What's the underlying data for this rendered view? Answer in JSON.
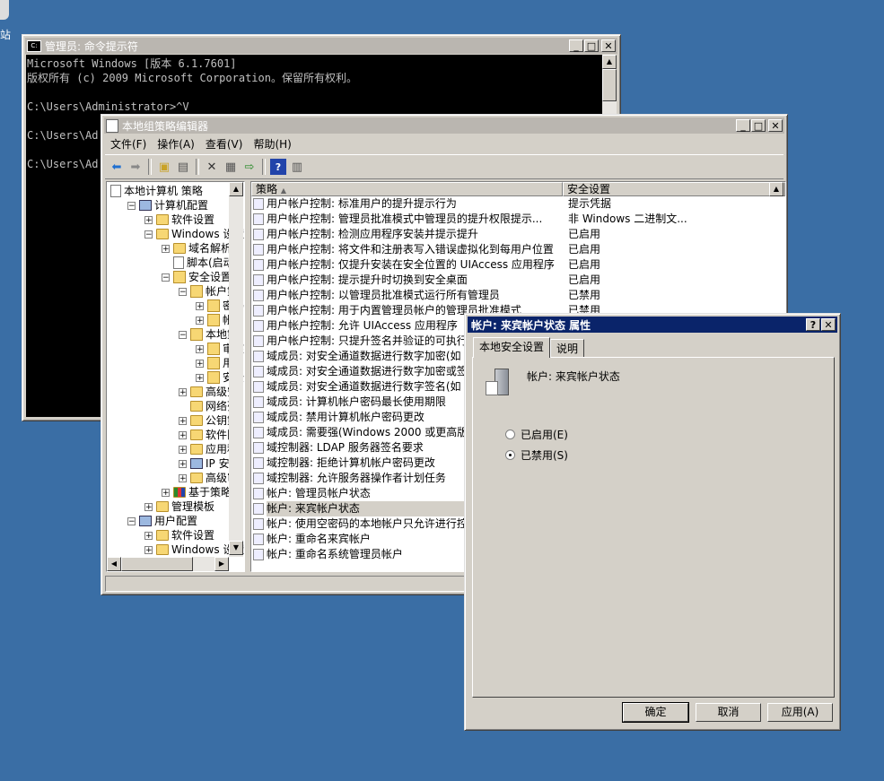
{
  "desktop": {
    "icon_label": "站"
  },
  "cmd": {
    "title": "管理员: 命令提示符",
    "lines": [
      "Microsoft Windows [版本 6.1.7601]",
      "版权所有 (c) 2009 Microsoft Corporation。保留所有权利。",
      "",
      "C:\\Users\\Administrator>^V",
      "",
      "C:\\Users\\Ad",
      "",
      "C:\\Users\\Ad"
    ]
  },
  "gpedit": {
    "title": "本地组策略编辑器",
    "menu": [
      "文件(F)",
      "操作(A)",
      "查看(V)",
      "帮助(H)"
    ],
    "tree": [
      {
        "label": "本地计算机 策略",
        "indent": 0,
        "icon": "doc-icon",
        "exp": ""
      },
      {
        "label": "计算机配置",
        "indent": 1,
        "icon": "computer-icon",
        "exp": "−"
      },
      {
        "label": "软件设置",
        "indent": 2,
        "icon": "folder-icon",
        "exp": "+"
      },
      {
        "label": "Windows 设置",
        "indent": 2,
        "icon": "folder-icon",
        "exp": "−"
      },
      {
        "label": "域名解析策",
        "indent": 3,
        "icon": "folder-icon",
        "exp": "+"
      },
      {
        "label": "脚本(启动",
        "indent": 3,
        "icon": "script-icon",
        "exp": ""
      },
      {
        "label": "安全设置",
        "indent": 3,
        "icon": "lock-icon",
        "exp": "−"
      },
      {
        "label": "帐户策",
        "indent": 4,
        "icon": "lock-icon",
        "exp": "−"
      },
      {
        "label": "密码",
        "indent": 5,
        "icon": "lock-icon",
        "exp": "+"
      },
      {
        "label": "帐户",
        "indent": 5,
        "icon": "lock-icon",
        "exp": "+"
      },
      {
        "label": "本地策",
        "indent": 4,
        "icon": "lock-icon",
        "exp": "−"
      },
      {
        "label": "审核",
        "indent": 5,
        "icon": "lock-icon",
        "exp": "+"
      },
      {
        "label": "用户",
        "indent": 5,
        "icon": "lock-icon",
        "exp": "+"
      },
      {
        "label": "安全",
        "indent": 5,
        "icon": "lock-icon",
        "exp": "+"
      },
      {
        "label": "高级安",
        "indent": 4,
        "icon": "folder-icon",
        "exp": "+"
      },
      {
        "label": "网络列",
        "indent": 4,
        "icon": "folder-icon",
        "exp": ""
      },
      {
        "label": "公钥策",
        "indent": 4,
        "icon": "folder-icon",
        "exp": "+"
      },
      {
        "label": "软件限",
        "indent": 4,
        "icon": "folder-icon",
        "exp": "+"
      },
      {
        "label": "应用程",
        "indent": 4,
        "icon": "folder-icon",
        "exp": "+"
      },
      {
        "label": "IP 安全",
        "indent": 4,
        "icon": "ipsec-icon",
        "exp": "+"
      },
      {
        "label": "高级审",
        "indent": 4,
        "icon": "folder-icon",
        "exp": "+"
      },
      {
        "label": "基于策略的",
        "indent": 3,
        "icon": "chart-icon",
        "exp": "+"
      },
      {
        "label": "管理模板",
        "indent": 2,
        "icon": "folder-icon",
        "exp": "+"
      },
      {
        "label": "用户配置",
        "indent": 1,
        "icon": "user-icon",
        "exp": "−"
      },
      {
        "label": "软件设置",
        "indent": 2,
        "icon": "folder-icon",
        "exp": "+"
      },
      {
        "label": "Windows 设置",
        "indent": 2,
        "icon": "folder-icon",
        "exp": "+"
      }
    ],
    "columns": {
      "policy": "策略",
      "setting": "安全设置"
    },
    "rows": [
      {
        "policy": "用户帐户控制: 标准用户的提升提示行为",
        "setting": "提示凭据"
      },
      {
        "policy": "用户帐户控制: 管理员批准模式中管理员的提升权限提示...",
        "setting": "非 Windows 二进制文..."
      },
      {
        "policy": "用户帐户控制: 检测应用程序安装并提示提升",
        "setting": "已启用"
      },
      {
        "policy": "用户帐户控制: 将文件和注册表写入错误虚拟化到每用户位置",
        "setting": "已启用"
      },
      {
        "policy": "用户帐户控制: 仅提升安装在安全位置的 UIAccess 应用程序",
        "setting": "已启用"
      },
      {
        "policy": "用户帐户控制: 提示提升时切换到安全桌面",
        "setting": "已启用"
      },
      {
        "policy": "用户帐户控制: 以管理员批准模式运行所有管理员",
        "setting": "已禁用"
      },
      {
        "policy": "用户帐户控制: 用于内置管理员帐户的管理员批准模式",
        "setting": "已禁用"
      },
      {
        "policy": "用户帐户控制: 允许 UIAccess 应用程序",
        "setting": ""
      },
      {
        "policy": "用户帐户控制: 只提升签名并验证的可执行",
        "setting": ""
      },
      {
        "policy": "域成员: 对安全通道数据进行数字加密(如",
        "setting": ""
      },
      {
        "policy": "域成员: 对安全通道数据进行数字加密或签",
        "setting": ""
      },
      {
        "policy": "域成员: 对安全通道数据进行数字签名(如",
        "setting": ""
      },
      {
        "policy": "域成员: 计算机帐户密码最长使用期限",
        "setting": ""
      },
      {
        "policy": "域成员: 禁用计算机帐户密码更改",
        "setting": ""
      },
      {
        "policy": "域成员: 需要强(Windows 2000 或更高版本",
        "setting": ""
      },
      {
        "policy": "域控制器: LDAP 服务器签名要求",
        "setting": ""
      },
      {
        "policy": "域控制器: 拒绝计算机帐户密码更改",
        "setting": ""
      },
      {
        "policy": "域控制器: 允许服务器操作者计划任务",
        "setting": ""
      },
      {
        "policy": "帐户: 管理员帐户状态",
        "setting": ""
      },
      {
        "policy": "帐户: 来宾帐户状态",
        "setting": ""
      },
      {
        "policy": "帐户: 使用空密码的本地帐户只允许进行控",
        "setting": ""
      },
      {
        "policy": "帐户: 重命名来宾帐户",
        "setting": ""
      },
      {
        "policy": "帐户: 重命名系统管理员帐户",
        "setting": ""
      }
    ]
  },
  "dialog": {
    "title": "帐户: 来宾帐户状态 属性",
    "tabs": [
      "本地安全设置",
      "说明"
    ],
    "policy_name": "帐户: 来宾帐户状态",
    "radio_enabled": "已启用(E)",
    "radio_disabled": "已禁用(S)",
    "selected": "disabled",
    "ok": "确定",
    "cancel": "取消",
    "apply": "应用(A)"
  }
}
